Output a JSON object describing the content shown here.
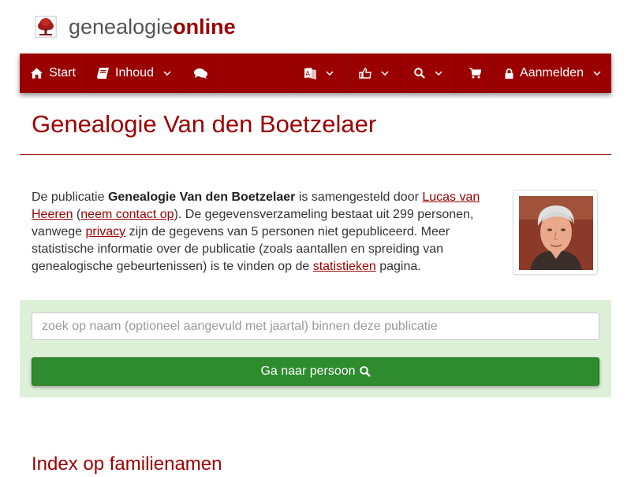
{
  "brand": {
    "name_part1": "genealogie",
    "name_part2": "online",
    "accent": "#9b0000"
  },
  "nav": {
    "items": [
      {
        "label": "Start",
        "icon": "home-icon"
      },
      {
        "label": "Inhoud",
        "icon": "book-icon"
      },
      {
        "label": "",
        "icon": "comments-icon"
      },
      {
        "label": "",
        "icon": "language-icon"
      },
      {
        "label": "",
        "icon": "thumbs-up-icon"
      },
      {
        "label": "",
        "icon": "search-icon"
      },
      {
        "label": "",
        "icon": "shopping-cart-icon"
      },
      {
        "label": "Aanmelden",
        "icon": "lock-icon"
      }
    ]
  },
  "page": {
    "title": "Genealogie Van den Boetzelaer",
    "intro": {
      "t1": "De publicatie ",
      "publication": "Genealogie Van den Boetzelaer",
      "t2": " is samengesteld door ",
      "author": "Lucas van Heeren",
      "t3": " (",
      "contact": "neem contact op",
      "t4": "). De gegevensverzameling bestaat uit 299 personen, vanwege ",
      "privacy": "privacy",
      "t5": " zijn de gegevens van 5 personen niet gepubliceerd. Meer statistische informatie over de publicatie (zoals aantallen en spreiding van genealogische gebeurtenissen) is te vinden op de ",
      "stats": "statistieken",
      "t6": " pagina."
    },
    "author_photo_alt": "author-photo"
  },
  "search": {
    "placeholder": "zoek op naam (optioneel aangevuld met jaartal) binnen deze publicatie",
    "button_label": "Ga naar persoon",
    "panel_color": "#dff0d8",
    "button_color": "#2e8b2e"
  },
  "index": {
    "heading": "Index op familienamen"
  }
}
